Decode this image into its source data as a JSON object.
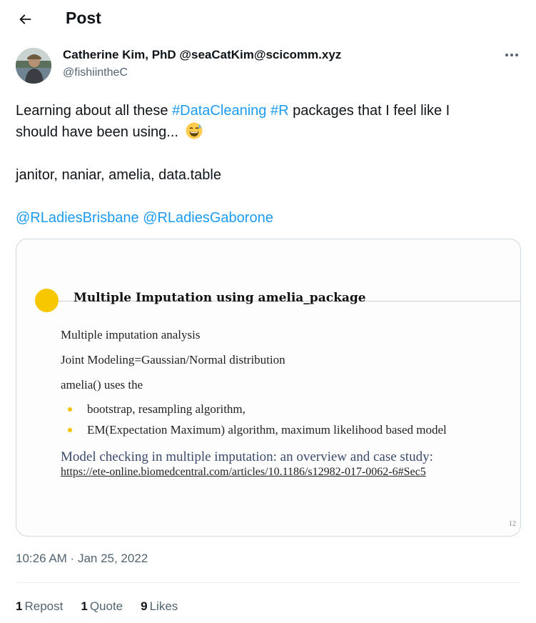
{
  "header": {
    "title": "Post",
    "back_icon": "arrow-left-icon"
  },
  "author": {
    "name": "Catherine Kim, PhD @seaCatKim@scicomm.xyz",
    "handle": "@fishiintheC"
  },
  "tweet": {
    "text_part1": "Learning about all these ",
    "hashtag1": "#DataCleaning",
    "space": " ",
    "hashtag2": "#R",
    "text_part2": " packages that I feel like I",
    "text_line2": "should have been using... ",
    "emoji": "grinning-sweat-emoji",
    "packages_line": "janitor, naniar, amelia, data.table",
    "mention1": "@RLadiesBrisbane",
    "mention2": "@RLadiesGaborone"
  },
  "slide": {
    "title": "Multiple Imputation using amelia_package",
    "line1": "Multiple imputation analysis",
    "line2": "Joint Modeling=Gaussian/Normal distribution",
    "line3": "amelia() uses the",
    "bullets": [
      "bootstrap, resampling algorithm,",
      "EM(Expectation Maximum) algorithm, maximum likelihood based model"
    ],
    "link_title": "Model checking in multiple imputation: an overview and case study:",
    "url": "https://ete-online.biomedcentral.com/articles/10.1186/s12982-017-0062-6#Sec5",
    "page_number": "12",
    "accent_color": "#f7c700"
  },
  "meta": {
    "time": "10:26 AM",
    "separator": " · ",
    "date": "Jan 25, 2022"
  },
  "stats": {
    "reposts_count": "1",
    "reposts_label": "Repost",
    "quotes_count": "1",
    "quotes_label": "Quote",
    "likes_count": "9",
    "likes_label": "Likes"
  },
  "colors": {
    "link": "#1d9bf0",
    "secondary_text": "#536471",
    "primary_text": "#0f1419"
  }
}
